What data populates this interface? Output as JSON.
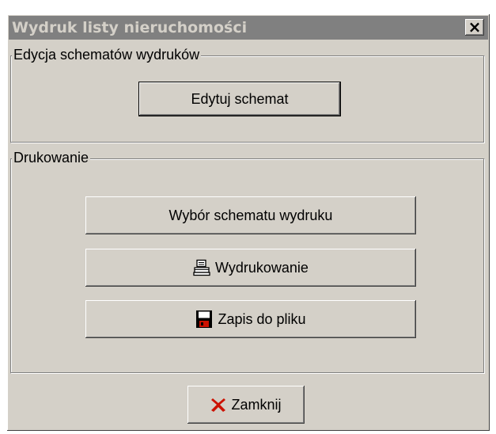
{
  "window": {
    "title": "Wydruk listy nieruchomości",
    "close_glyph": "×"
  },
  "edit_group": {
    "legend": "Edycja schematów wydruków",
    "edit_button": "Edytuj schemat"
  },
  "print_group": {
    "legend": "Drukowanie",
    "choose_button": "Wybór schematu wydruku",
    "print_button": "Wydrukowanie",
    "print_icon": "printer-icon",
    "save_button": "Zapis do pliku",
    "save_icon": "floppy-disk-icon"
  },
  "footer": {
    "close_button": "Zamknij",
    "close_icon": "red-x-icon"
  },
  "colors": {
    "face": "#d4d0c8",
    "titlebar_inactive": "#808080",
    "close_red": "#cc1100"
  }
}
